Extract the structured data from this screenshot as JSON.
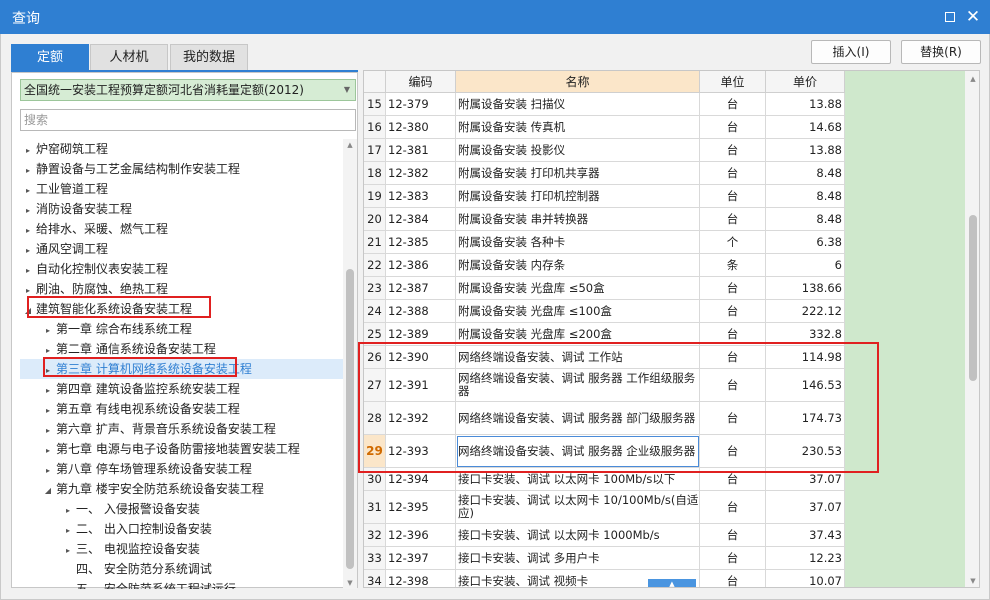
{
  "window": {
    "title": "查询"
  },
  "tabs": [
    {
      "label": "定额",
      "active": true
    },
    {
      "label": "人材机",
      "active": false
    },
    {
      "label": "我的数据",
      "active": false
    }
  ],
  "buttons": {
    "insert": "插入(I)",
    "replace": "替换(R)"
  },
  "library": {
    "selected": "全国统一安装工程预算定额河北省消耗量定额(2012)"
  },
  "search": {
    "placeholder": "搜索"
  },
  "tree": [
    {
      "label": "炉窑砌筑工程",
      "level": 0,
      "toggle": "▸"
    },
    {
      "label": "静置设备与工艺金属结构制作安装工程",
      "level": 0,
      "toggle": "▸"
    },
    {
      "label": "工业管道工程",
      "level": 0,
      "toggle": "▸"
    },
    {
      "label": "消防设备安装工程",
      "level": 0,
      "toggle": "▸"
    },
    {
      "label": "给排水、采暖、燃气工程",
      "level": 0,
      "toggle": "▸"
    },
    {
      "label": "通风空调工程",
      "level": 0,
      "toggle": "▸"
    },
    {
      "label": "自动化控制仪表安装工程",
      "level": 0,
      "toggle": "▸"
    },
    {
      "label": "刷油、防腐蚀、绝热工程",
      "level": 0,
      "toggle": "▸"
    },
    {
      "label": "建筑智能化系统设备安装工程",
      "level": 0,
      "toggle": "◢"
    },
    {
      "label": "第一章 综合布线系统工程",
      "level": 1,
      "toggle": "▸"
    },
    {
      "label": "第二章 通信系统设备安装工程",
      "level": 1,
      "toggle": "▸"
    },
    {
      "label": "第三章 计算机网络系统设备安装工程",
      "level": 1,
      "toggle": "▸",
      "selected": true
    },
    {
      "label": "第四章 建筑设备监控系统安装工程",
      "level": 1,
      "toggle": "▸"
    },
    {
      "label": "第五章 有线电视系统设备安装工程",
      "level": 1,
      "toggle": "▸"
    },
    {
      "label": "第六章 扩声、背景音乐系统设备安装工程",
      "level": 1,
      "toggle": "▸"
    },
    {
      "label": "第七章 电源与电子设备防雷接地装置安装工程",
      "level": 1,
      "toggle": "▸"
    },
    {
      "label": "第八章 停车场管理系统设备安装工程",
      "level": 1,
      "toggle": "▸"
    },
    {
      "label": "第九章 楼宇安全防范系统设备安装工程",
      "level": 1,
      "toggle": "◢"
    },
    {
      "label": "一、 入侵报警设备安装",
      "level": 2,
      "toggle": "▸"
    },
    {
      "label": "二、 出入口控制设备安装",
      "level": 2,
      "toggle": "▸"
    },
    {
      "label": "三、 电视监控设备安装",
      "level": 2,
      "toggle": "▸"
    },
    {
      "label": "四、 安全防范分系统调试",
      "level": 2,
      "toggle": ""
    },
    {
      "label": "五、 安全防范系统工程试运行",
      "level": 2,
      "toggle": ""
    }
  ],
  "table": {
    "headers": {
      "code": "编码",
      "name": "名称",
      "unit": "单位",
      "price": "单价"
    },
    "rows": [
      {
        "idx": "15",
        "code": "12-379",
        "name": "附属设备安装 扫描仪",
        "unit": "台",
        "price": "13.88"
      },
      {
        "idx": "16",
        "code": "12-380",
        "name": "附属设备安装 传真机",
        "unit": "台",
        "price": "14.68"
      },
      {
        "idx": "17",
        "code": "12-381",
        "name": "附属设备安装 投影仪",
        "unit": "台",
        "price": "13.88"
      },
      {
        "idx": "18",
        "code": "12-382",
        "name": "附属设备安装 打印机共享器",
        "unit": "台",
        "price": "8.48"
      },
      {
        "idx": "19",
        "code": "12-383",
        "name": "附属设备安装 打印机控制器",
        "unit": "台",
        "price": "8.48"
      },
      {
        "idx": "20",
        "code": "12-384",
        "name": "附属设备安装 串并转换器",
        "unit": "台",
        "price": "8.48"
      },
      {
        "idx": "21",
        "code": "12-385",
        "name": "附属设备安装 各种卡",
        "unit": "个",
        "price": "6.38"
      },
      {
        "idx": "22",
        "code": "12-386",
        "name": "附属设备安装 内存条",
        "unit": "条",
        "price": "6"
      },
      {
        "idx": "23",
        "code": "12-387",
        "name": "附属设备安装 光盘库 ≤50盒",
        "unit": "台",
        "price": "138.66"
      },
      {
        "idx": "24",
        "code": "12-388",
        "name": "附属设备安装 光盘库 ≤100盒",
        "unit": "台",
        "price": "222.12"
      },
      {
        "idx": "25",
        "code": "12-389",
        "name": "附属设备安装 光盘库 ≤200盒",
        "unit": "台",
        "price": "332.8"
      },
      {
        "idx": "26",
        "code": "12-390",
        "name": "网络终端设备安装、调试 工作站",
        "unit": "台",
        "price": "114.98"
      },
      {
        "idx": "27",
        "code": "12-391",
        "name": "网络终端设备安装、调试 服务器 工作组级服务器",
        "unit": "台",
        "price": "146.53"
      },
      {
        "idx": "28",
        "code": "12-392",
        "name": "网络终端设备安装、调试 服务器 部门级服务器",
        "unit": "台",
        "price": "174.73"
      },
      {
        "idx": "29",
        "code": "12-393",
        "name": "网络终端设备安装、调试 服务器 企业级服务器",
        "unit": "台",
        "price": "230.53"
      },
      {
        "idx": "30",
        "code": "12-394",
        "name": "接口卡安装、调试 以太网卡 100Mb/s以下",
        "unit": "台",
        "price": "37.07"
      },
      {
        "idx": "31",
        "code": "12-395",
        "name": "接口卡安装、调试 以太网卡 10/100Mb/s(自适应)",
        "unit": "台",
        "price": "37.07"
      },
      {
        "idx": "32",
        "code": "12-396",
        "name": "接口卡安装、调试 以太网卡 1000Mb/s",
        "unit": "台",
        "price": "37.43"
      },
      {
        "idx": "33",
        "code": "12-397",
        "name": "接口卡安装、调试 多用户卡",
        "unit": "台",
        "price": "12.23"
      },
      {
        "idx": "34",
        "code": "12-398",
        "name": "接口卡安装、调试 视频卡",
        "unit": "台",
        "price": "10.07"
      }
    ]
  }
}
